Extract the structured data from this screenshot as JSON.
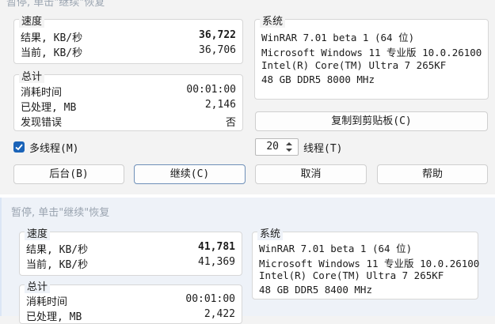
{
  "panel1": {
    "title": "暂停, 单击\"继续\"恢复",
    "speed": {
      "title": "速度",
      "result_label": "结果, KB/秒",
      "result_value": "36,722",
      "current_label": "当前, KB/秒",
      "current_value": "36,706"
    },
    "totals": {
      "title": "总计",
      "elapsed_label": "消耗时间",
      "elapsed_value": "00:01:00",
      "processed_label": "已处理, MB",
      "processed_value": "2,146",
      "errors_label": "发现错误",
      "errors_value": "否"
    },
    "system": {
      "title": "系统",
      "lines": [
        "WinRAR 7.01 beta 1 (64 位)",
        "Microsoft Windows 11 专业版 10.0.26100",
        "Intel(R) Core(TM) Ultra 7 265KF",
        "48 GB DDR5 8000 MHz"
      ]
    },
    "copy_button": "复制到剪贴板(C)",
    "multithread_label": "多线程(M)",
    "multithread_checked": true,
    "threads_value": "20",
    "threads_label": "线程(T)",
    "buttons": {
      "background": "后台(B)",
      "continue": "继续(C)",
      "cancel": "取消",
      "help": "帮助"
    }
  },
  "panel2": {
    "title": "暂停, 单击\"继续\"恢复",
    "speed": {
      "title": "速度",
      "result_label": "结果, KB/秒",
      "result_value": "41,781",
      "current_label": "当前, KB/秒",
      "current_value": "41,369"
    },
    "totals": {
      "title": "总计",
      "elapsed_label": "消耗时间",
      "elapsed_value": "00:01:00",
      "processed_label": "已处理, MB",
      "processed_value": "2,422"
    },
    "system": {
      "title": "系统",
      "lines": [
        "WinRAR 7.01 beta 1 (64 位)",
        "Microsoft Windows 11 专业版 10.0.26100",
        "Intel(R) Core(TM) Ultra 7 265KF",
        "48 GB DDR5 8400 MHz"
      ]
    }
  },
  "colors": {
    "accent": "#1a63b8",
    "title_gray": "#9aa4b0",
    "panel2_bg": "#eef2f8"
  },
  "icons": {
    "checkbox": "check-icon",
    "spinner": "up-down-arrows-icon"
  }
}
